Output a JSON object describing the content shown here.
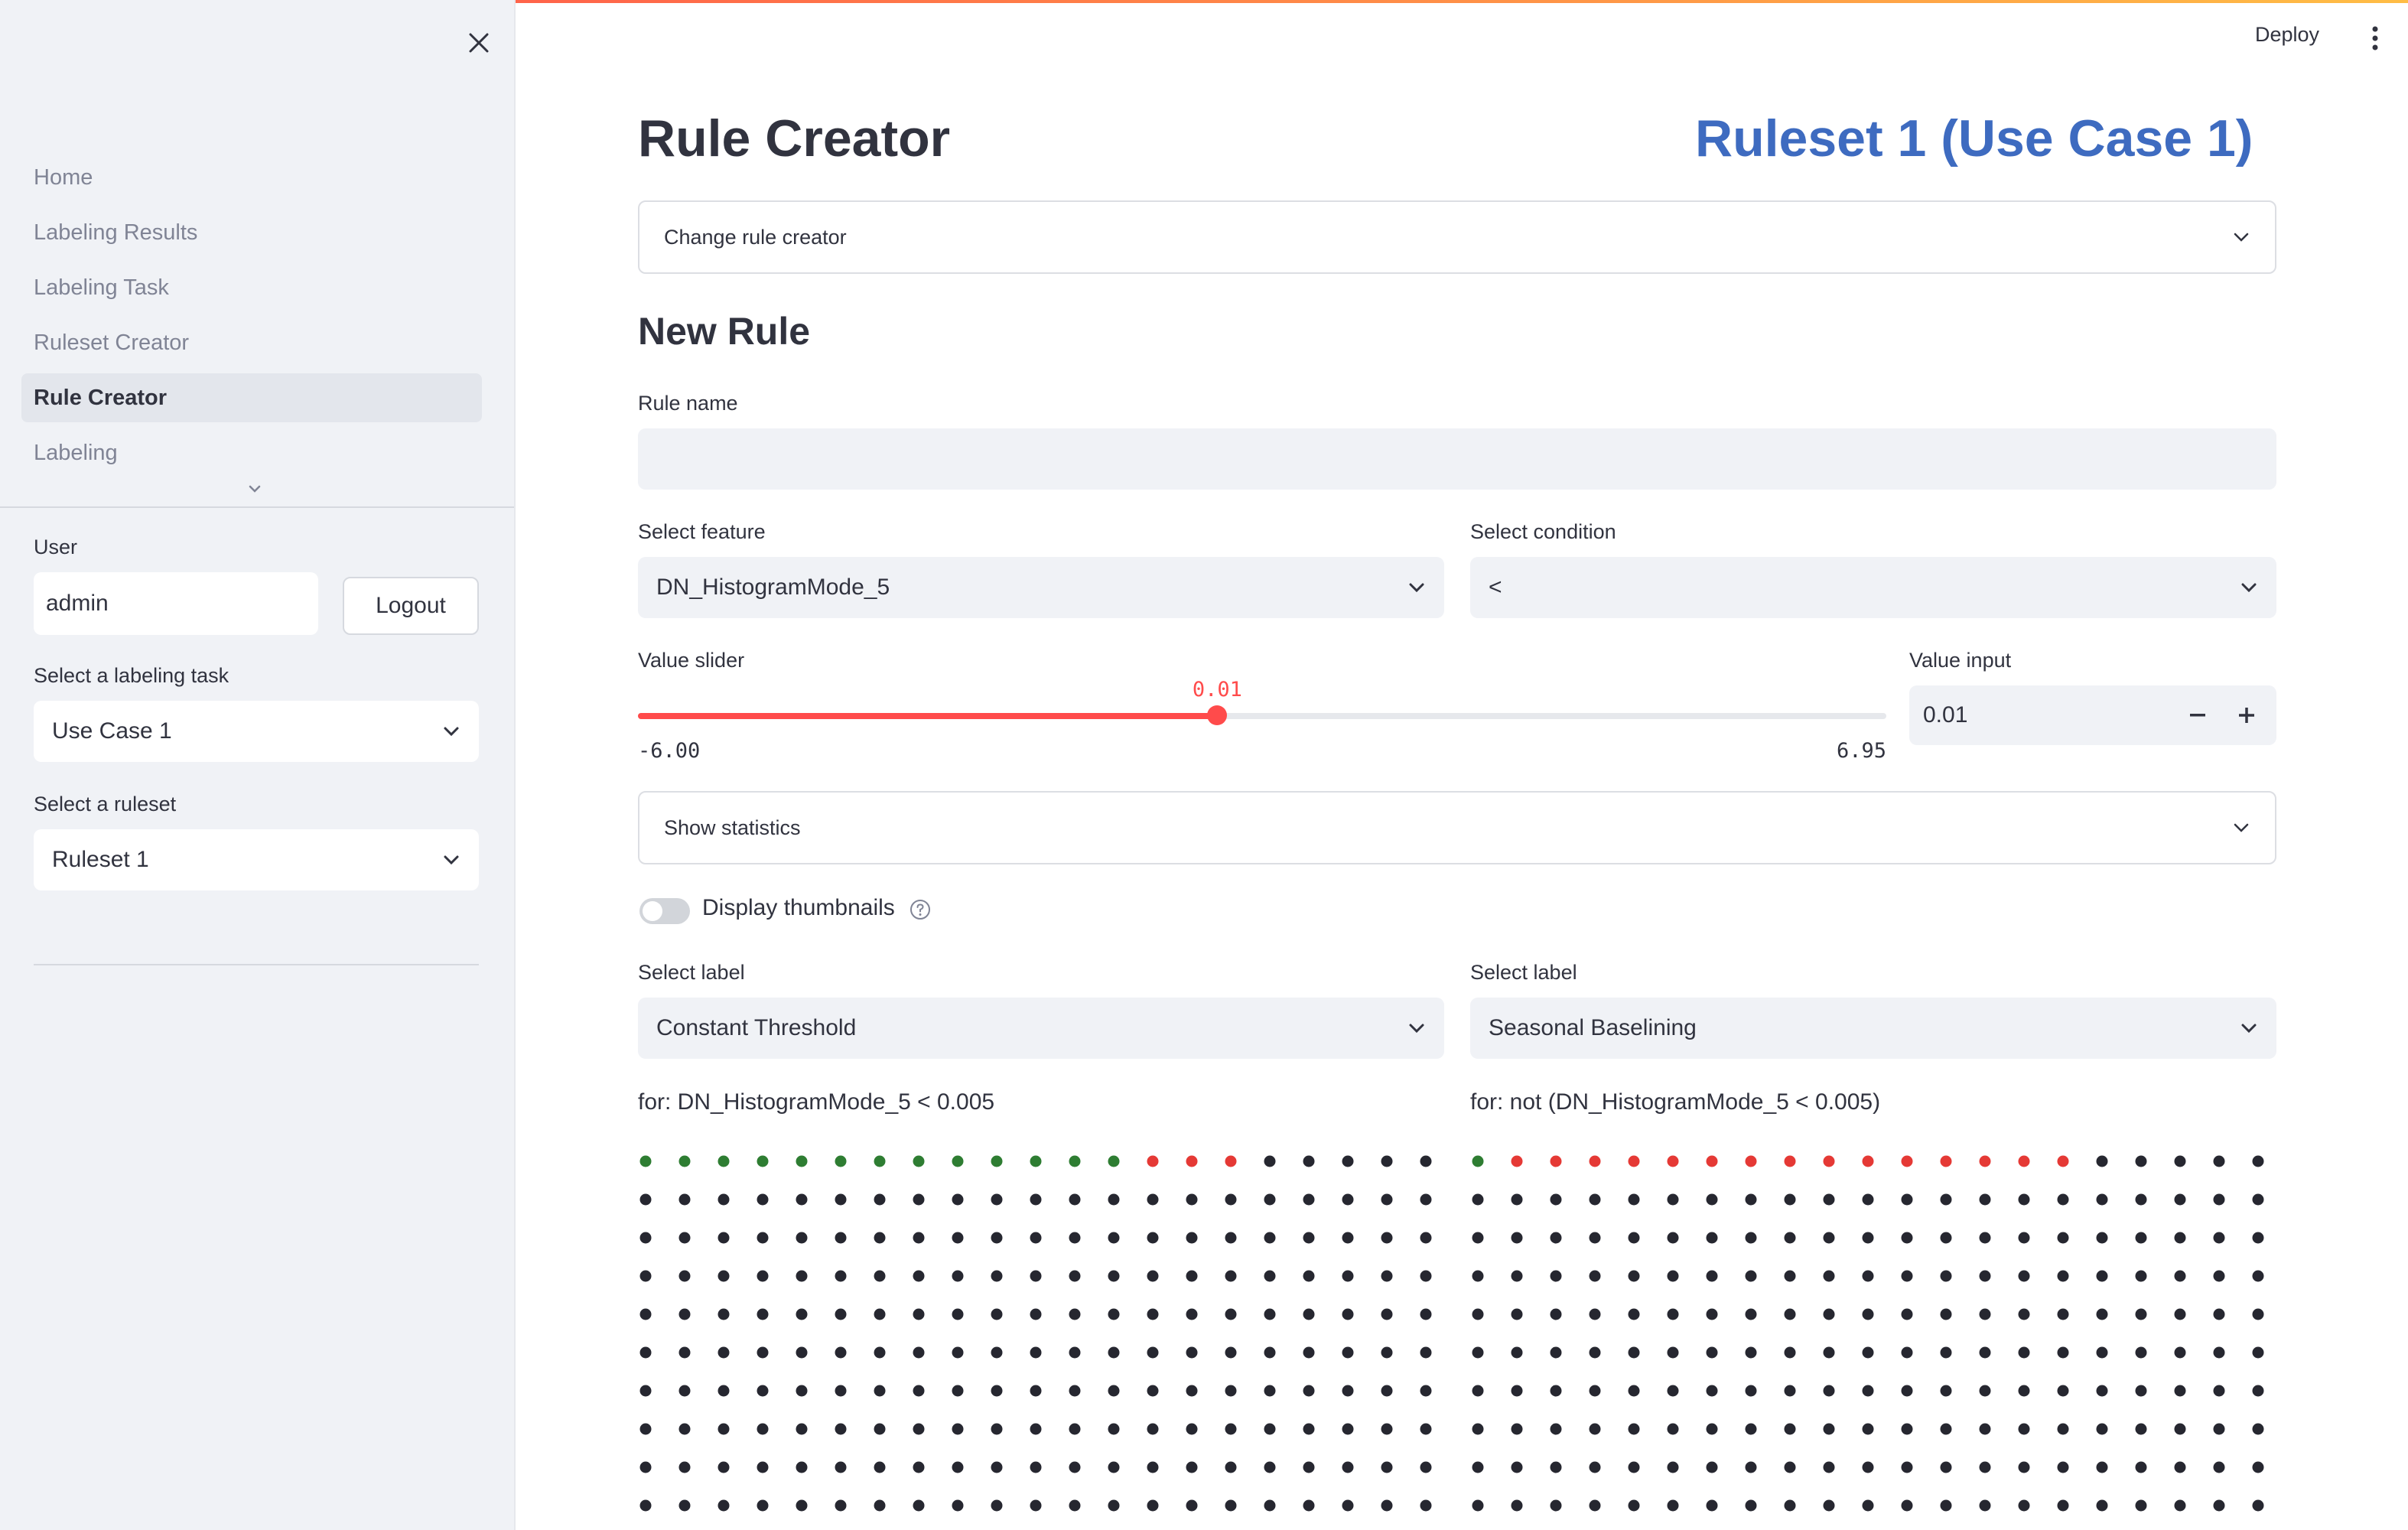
{
  "sidebar": {
    "nav": [
      {
        "label": "Home",
        "active": false
      },
      {
        "label": "Labeling Results",
        "active": false
      },
      {
        "label": "Labeling Task",
        "active": false
      },
      {
        "label": "Ruleset Creator",
        "active": false
      },
      {
        "label": "Rule Creator",
        "active": true
      },
      {
        "label": "Labeling",
        "active": false
      }
    ],
    "user_label": "User",
    "user_value": "admin",
    "logout_label": "Logout",
    "task_label": "Select a labeling task",
    "task_value": "Use Case 1",
    "ruleset_label": "Select a ruleset",
    "ruleset_value": "Ruleset 1"
  },
  "header": {
    "deploy_label": "Deploy"
  },
  "main": {
    "title": "Rule Creator",
    "ruleset_title": "Ruleset 1 (Use Case 1)",
    "change_rule_creator": "Change rule creator",
    "new_rule": "New Rule",
    "rule_name_label": "Rule name",
    "rule_name_value": "",
    "feature_label": "Select feature",
    "feature_value": "DN_HistogramMode_5",
    "condition_label": "Select condition",
    "condition_value": "<",
    "slider_label": "Value slider",
    "slider_value_text": "0.01",
    "slider_min_text": "-6.00",
    "slider_max_text": "6.95",
    "slider_value": 0.01,
    "slider_min": -6.0,
    "slider_max": 6.95,
    "value_input_label": "Value input",
    "value_input_value": "0.01",
    "show_statistics": "Show statistics",
    "display_thumbnails": "Display thumbnails",
    "label_left_label": "Select label",
    "label_left_value": "Constant Threshold",
    "label_right_label": "Select label",
    "label_right_value": "Seasonal Baselining",
    "for_left": "for: DN_HistogramMode_5 < 0.005",
    "for_right": "for: not (DN_HistogramMode_5 < 0.005)"
  },
  "dot_grids": {
    "left": {
      "rows_visible": 10,
      "cols": 21,
      "green": 13,
      "red": 3
    },
    "right": {
      "rows_visible": 10,
      "cols": 21,
      "green": 1,
      "red": 15
    }
  },
  "colors": {
    "accent": "#ff4b4b",
    "ruleset_title": "#3e6bc0",
    "dot_green": "#2e7d32",
    "dot_red": "#e53935",
    "dot_dark": "#262730"
  }
}
